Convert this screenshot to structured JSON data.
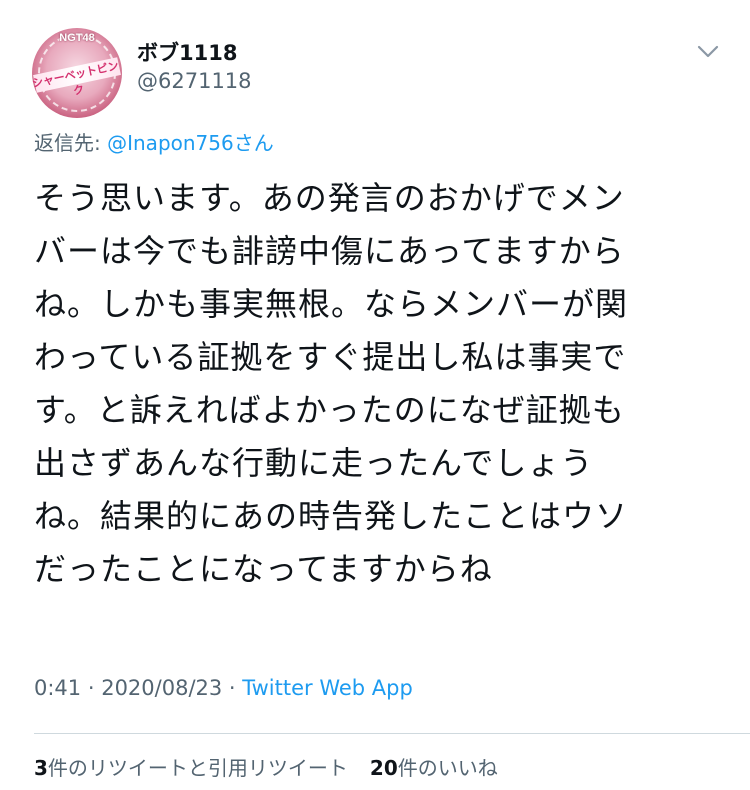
{
  "author": {
    "display_name": "ボブ1118",
    "handle": "@6271118",
    "avatar_badge": "NGT48",
    "avatar_band": "シャーベットピンク"
  },
  "reply": {
    "prefix": "返信先: ",
    "target": "@Inapon756",
    "suffix": "さん"
  },
  "tweet": {
    "lines": [
      "そう思います。あの発言のおかげでメン",
      "バーは今でも誹謗中傷にあってますから",
      "ね。しかも事実無根。ならメンバーが関",
      "わっている証拠をすぐ提出し私は事実で",
      "す。と訴えればよかったのになぜ証拠も",
      "出さずあんな行動に走ったんでしょう",
      "ね。結果的にあの時告発したことはウソ",
      "だったことになってますからね"
    ]
  },
  "meta": {
    "time": "0:41",
    "sep1": " · ",
    "date": "2020/08/23",
    "sep2": " · ",
    "source": "Twitter Web App"
  },
  "stats": {
    "retweets_count": "3",
    "retweets_label": "件のリツイートと引用リツイート",
    "likes_count": "20",
    "likes_label": "件のいいね"
  },
  "icons": {
    "caret": "chevron-down-icon"
  }
}
